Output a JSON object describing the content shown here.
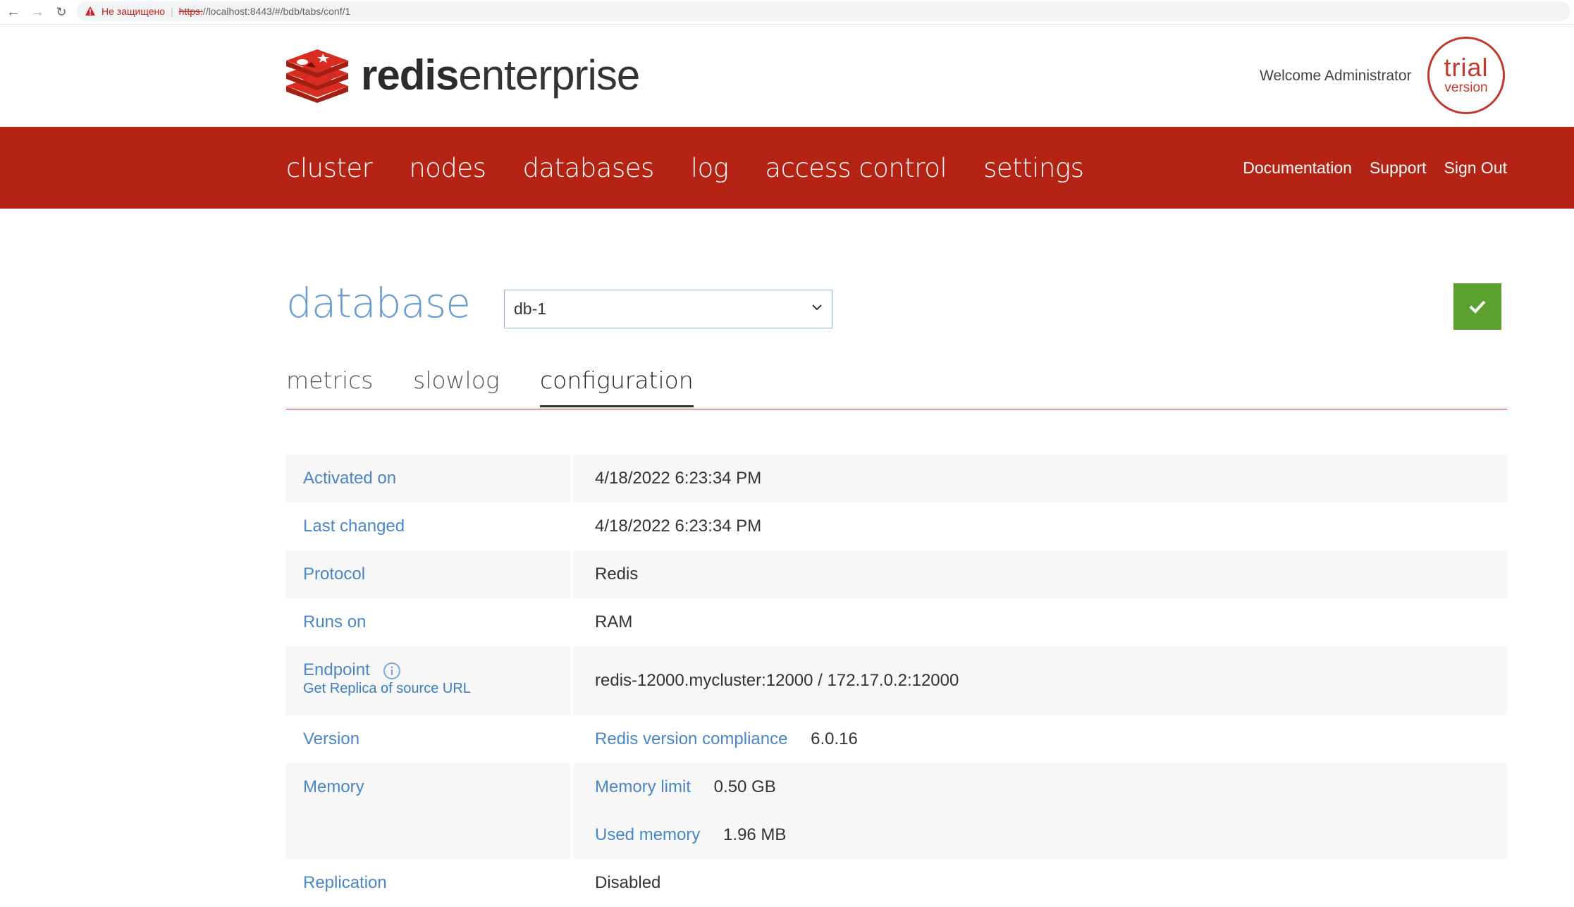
{
  "browser": {
    "security_label": "Не защищено",
    "url_scheme": "https:",
    "url_rest": "//localhost:8443/#/bdb/tabs/conf/1"
  },
  "header": {
    "logo_bold": "redis",
    "logo_light": "enterprise",
    "welcome": "Welcome Administrator",
    "trial_top": "trial",
    "trial_bottom": "version"
  },
  "nav": {
    "main": [
      "cluster",
      "nodes",
      "databases",
      "log",
      "access control",
      "settings"
    ],
    "right": [
      "Documentation",
      "Support",
      "Sign Out"
    ],
    "color": "#b52314"
  },
  "database": {
    "title": "database",
    "selected": "db-1"
  },
  "tabs": [
    "metrics",
    "slowlog",
    "configuration"
  ],
  "active_tab": "configuration",
  "config": {
    "activated_label": "Activated on",
    "activated_value": "4/18/2022 6:23:34 PM",
    "changed_label": "Last changed",
    "changed_value": "4/18/2022 6:23:34 PM",
    "protocol_label": "Protocol",
    "protocol_value": "Redis",
    "runs_label": "Runs on",
    "runs_value": "RAM",
    "endpoint_label": "Endpoint",
    "endpoint_sub": "Get Replica of source URL",
    "endpoint_value": "redis-12000.mycluster:12000 / 172.17.0.2:12000",
    "version_label": "Version",
    "version_key": "Redis version compliance",
    "version_value": "6.0.16",
    "memory_label": "Memory",
    "memory_limit_key": "Memory limit",
    "memory_limit_value": "0.50 GB",
    "used_memory_key": "Used memory",
    "used_memory_value": "1.96 MB",
    "replication_label": "Replication",
    "replication_value": "Disabled"
  }
}
